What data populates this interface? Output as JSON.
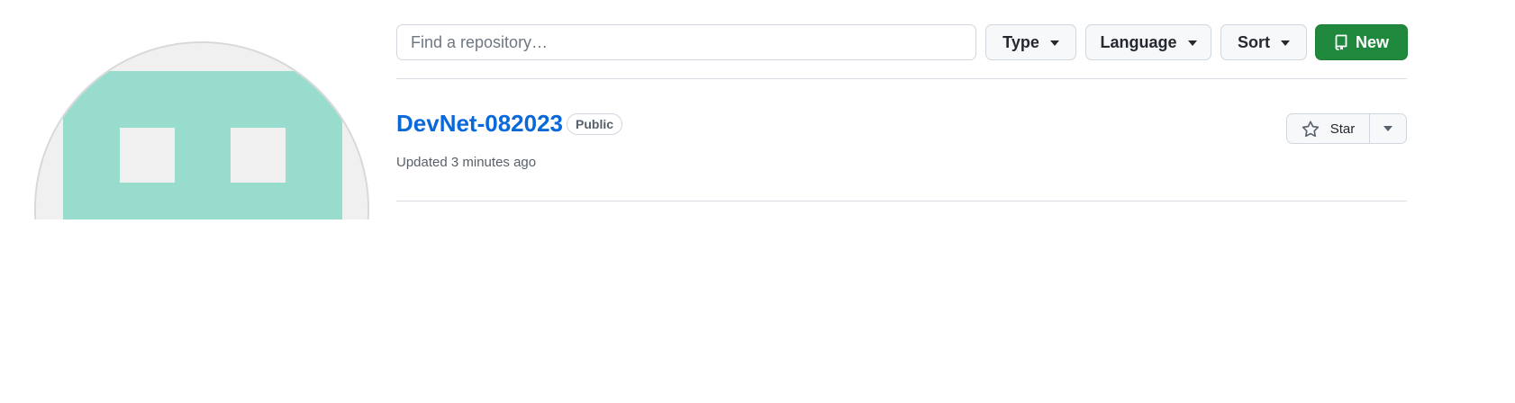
{
  "search": {
    "placeholder": "Find a repository…",
    "value": ""
  },
  "filters": {
    "type_label": "Type",
    "language_label": "Language",
    "sort_label": "Sort",
    "new_label": "New"
  },
  "repository": {
    "name": "DevNet-082023",
    "visibility": "Public",
    "updated": "Updated 3 minutes ago",
    "star_label": "Star"
  },
  "colors": {
    "link": "#0969da",
    "new_button": "#1f883d",
    "avatar_fill": "#98dccd",
    "avatar_background": "#f0f0f0"
  },
  "icons": {
    "new_button": "repo-icon",
    "star_button": "star-icon",
    "dropdowns": "triangle-down-icon"
  }
}
